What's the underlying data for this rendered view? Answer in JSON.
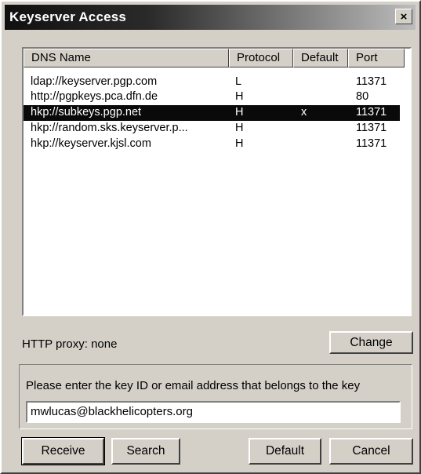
{
  "window": {
    "title": "Keyserver Access",
    "close_glyph": "×"
  },
  "listview": {
    "columns": [
      "DNS Name",
      "Protocol",
      "Default",
      "Port"
    ],
    "rows": [
      {
        "dns": "ldap://keyserver.pgp.com",
        "protocol": "L",
        "default": "",
        "port": "11371"
      },
      {
        "dns": "http://pgpkeys.pca.dfn.de",
        "protocol": "H",
        "default": "",
        "port": "80"
      },
      {
        "dns": "hkp://subkeys.pgp.net",
        "protocol": "H",
        "default": "x",
        "port": "11371"
      },
      {
        "dns": "hkp://random.sks.keyserver.p...",
        "protocol": "H",
        "default": "",
        "port": "11371"
      },
      {
        "dns": "hkp://keyserver.kjsl.com",
        "protocol": "H",
        "default": "",
        "port": "11371"
      }
    ],
    "selected_row_index": 2
  },
  "proxy": {
    "label": "HTTP proxy: none",
    "change_button": "Change"
  },
  "keyid": {
    "prompt": "Please enter the key ID or email address that belongs to the key",
    "value": "mwlucas@blackhelicopters.org"
  },
  "buttons": {
    "receive": "Receive",
    "search": "Search",
    "default": "Default",
    "cancel": "Cancel"
  },
  "colors": {
    "face": "#d4d0c8",
    "selection": "#0a0a0a",
    "titlebar": "#101010"
  }
}
